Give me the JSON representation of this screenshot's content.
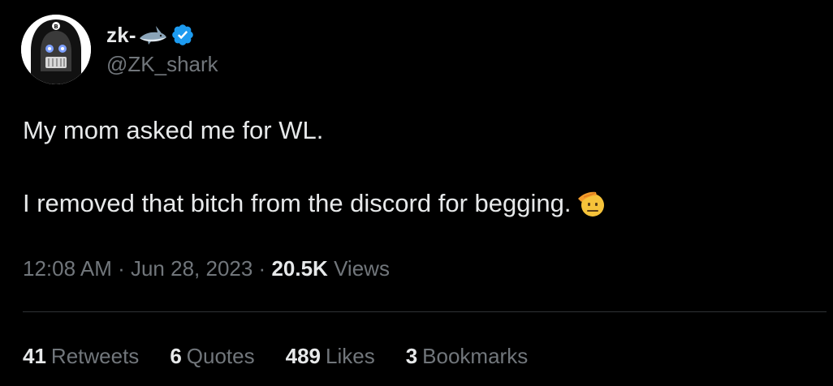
{
  "author": {
    "display_name": "zk-",
    "handle": "@ZK_shark",
    "avatar_icon": "hooded-bitcoin-figure-avatar",
    "name_emoji_icon": "shark-icon",
    "verified_icon": "verified-badge-icon",
    "verified_color": "#1d9bf0"
  },
  "tweet": {
    "line1": "My mom asked me for WL.",
    "line2": "I removed that bitch from the discord for begging.",
    "trailing_emoji_icon": "saluting-face-icon"
  },
  "meta": {
    "time": "12:08 AM",
    "separator": " · ",
    "date": "Jun 28, 2023",
    "views_count": "20.5K",
    "views_label": "Views"
  },
  "stats": {
    "retweets_count": "41",
    "retweets_label": "Retweets",
    "quotes_count": "6",
    "quotes_label": "Quotes",
    "likes_count": "489",
    "likes_label": "Likes",
    "bookmarks_count": "3",
    "bookmarks_label": "Bookmarks"
  },
  "colors": {
    "background": "#000000",
    "primary_text": "#e7e9ea",
    "secondary_text": "#71767b",
    "divider": "#2f3336"
  }
}
